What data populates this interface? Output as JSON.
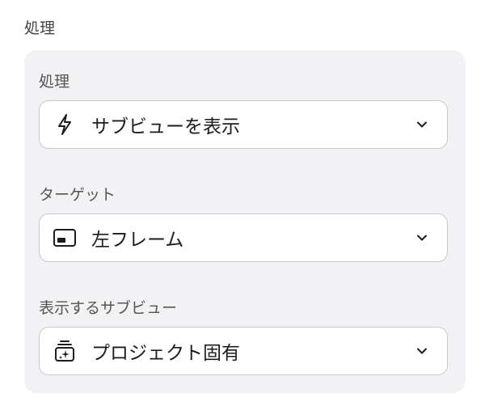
{
  "section": {
    "title": "処理"
  },
  "fields": {
    "action": {
      "label": "処理",
      "value": "サブビューを表示",
      "icon": "lightning-icon"
    },
    "target": {
      "label": "ターゲット",
      "value": "左フレーム",
      "icon": "left-frame-icon"
    },
    "subview": {
      "label": "表示するサブビュー",
      "value": "プロジェクト固有",
      "icon": "project-stack-icon"
    }
  }
}
